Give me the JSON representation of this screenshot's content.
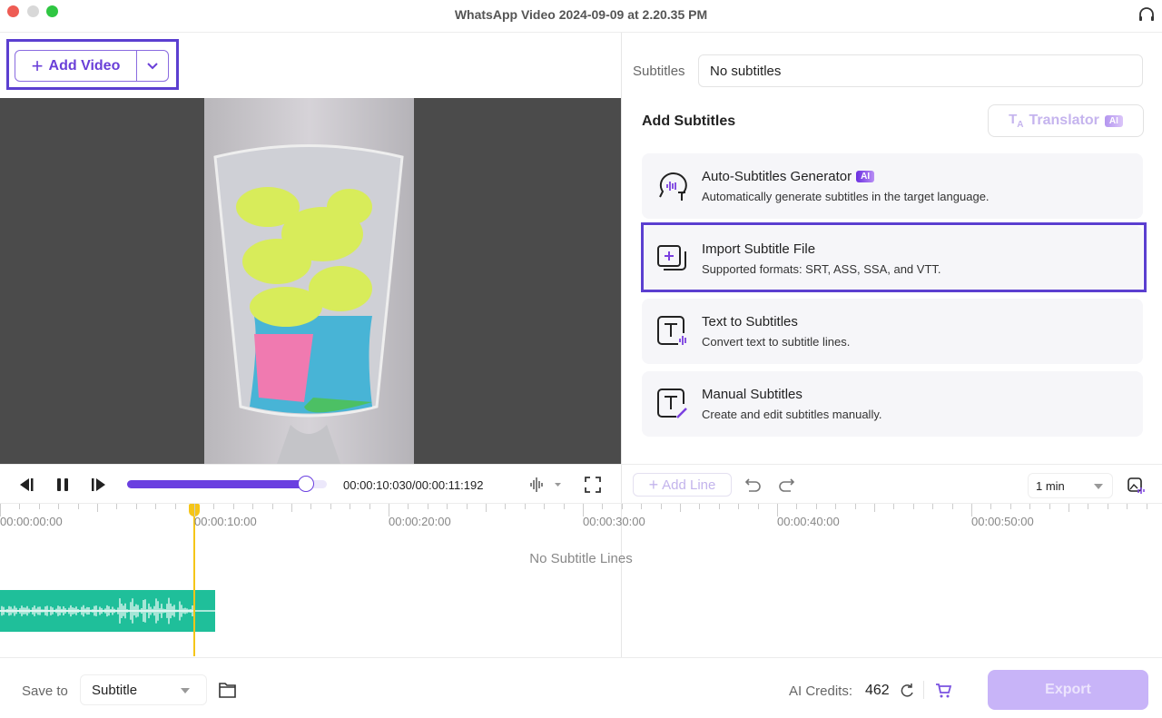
{
  "window": {
    "title": "WhatsApp Video 2024-09-09 at 2.20.35 PM"
  },
  "toolbar": {
    "add_video_label": "Add Video"
  },
  "player": {
    "current_time": "00:00:10:030",
    "total_time": "00:00:11:192",
    "progress_percent": 89.6
  },
  "subtitles": {
    "label": "Subtitles",
    "value": "No subtitles"
  },
  "add_subtitles": {
    "heading": "Add Subtitles",
    "translator_label": "Translator",
    "ai_badge": "AI",
    "options": [
      {
        "title": "Auto-Subtitles Generator",
        "desc": "Automatically generate subtitles in the target language.",
        "ai": "AI",
        "icon": "speech-bubble-waveform-icon"
      },
      {
        "title": "Import Subtitle File",
        "desc": "Supported formats: SRT, ASS, SSA, and VTT.",
        "icon": "import-file-icon"
      },
      {
        "title": "Text to Subtitles",
        "desc": "Convert text to subtitle lines.",
        "icon": "text-waveform-icon"
      },
      {
        "title": "Manual Subtitles",
        "desc": "Create and edit subtitles manually.",
        "icon": "text-edit-icon"
      }
    ]
  },
  "editor": {
    "add_line_label": "Add Line",
    "zoom_value": "1 min"
  },
  "timeline": {
    "labels": [
      "00:00:00:00",
      "00:00:10:00",
      "00:00:20:00",
      "00:00:30:00",
      "00:00:40:00",
      "00:00:50:00"
    ],
    "empty_text": "No Subtitle Lines",
    "playhead_seconds": 10
  },
  "footer": {
    "save_to_label": "Save to",
    "save_to_value": "Subtitle",
    "credits_label": "AI Credits:",
    "credits_value": "462",
    "export_label": "Export"
  },
  "colors": {
    "accent": "#6a3fd8",
    "highlight": "#5b3fd0",
    "waveform": "#1fbf9a",
    "playhead": "#f5c518"
  }
}
